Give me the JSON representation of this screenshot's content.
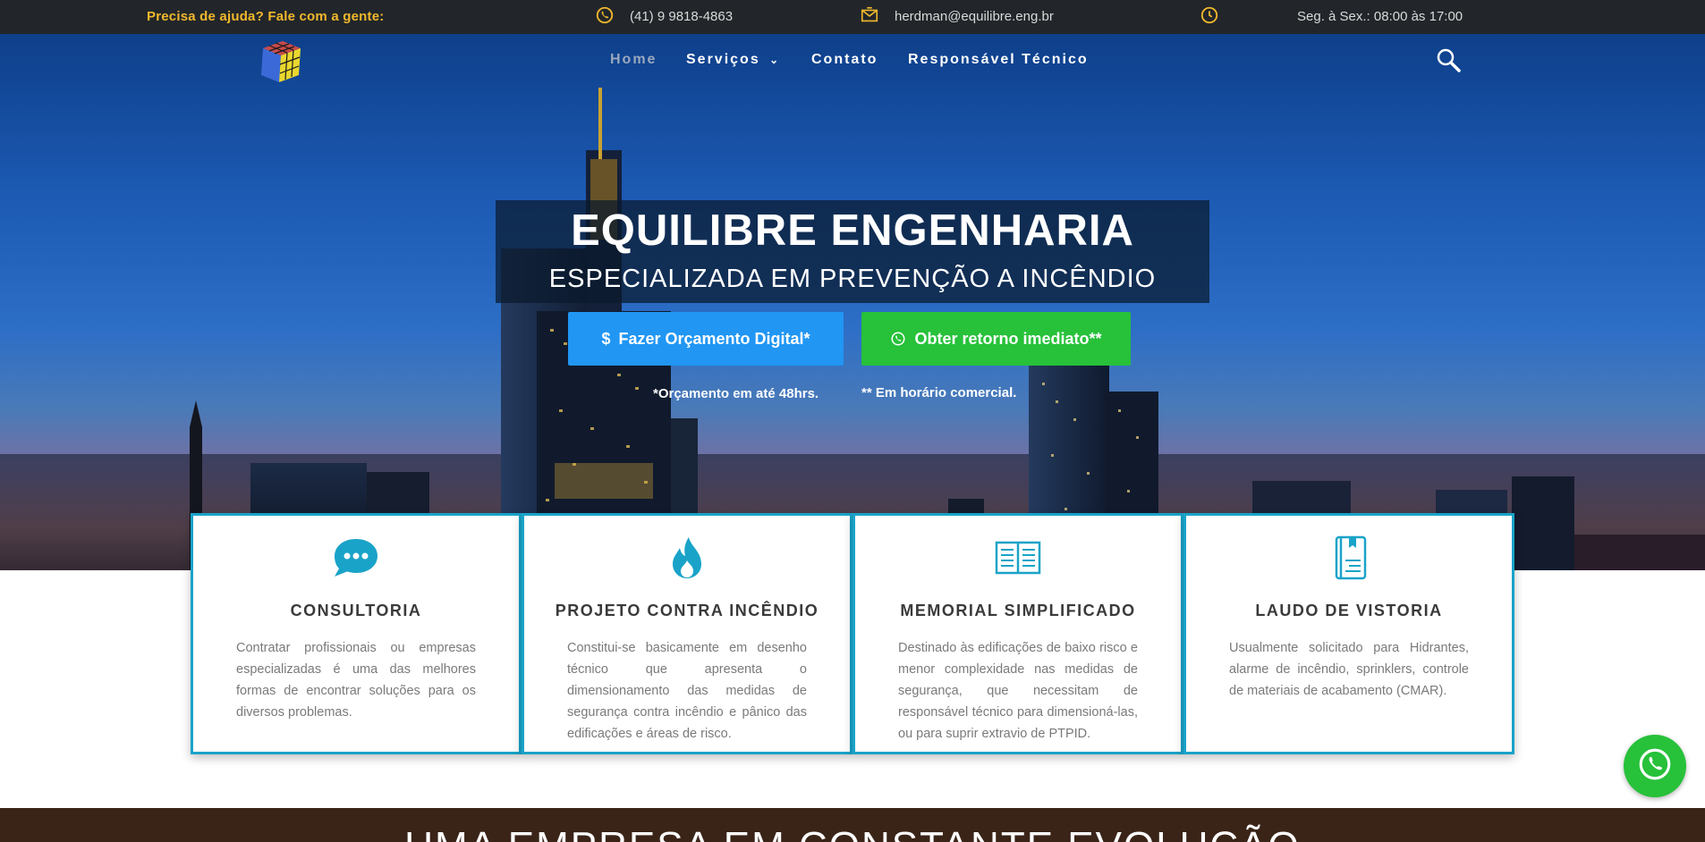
{
  "topbar": {
    "help": "Precisa de ajuda? Fale com a gente:",
    "phone": "(41) 9 9818-4863",
    "email": "herdman@equilibre.eng.br",
    "hours": "Seg. à Sex.: 08:00 às 17:00"
  },
  "nav": {
    "home": "Home",
    "services": "Serviços",
    "contact": "Contato",
    "technical": "Responsável Técnico"
  },
  "hero": {
    "title": "EQUILIBRE ENGENHARIA",
    "subtitle": "ESPECIALIZADA EM PREVENÇÃO A INCÊNDIO",
    "btn_quote": "Fazer Orçamento Digital*",
    "btn_callback": "Obter retorno imediato**",
    "note_quote": "*Orçamento em até 48hrs.",
    "note_callback": "** Em horário comercial."
  },
  "services": [
    {
      "title": "CONSULTORIA",
      "text": "Contratar profissionais ou empresas especializadas é uma das melhores formas de encontrar soluções para os diversos problemas.",
      "icon": "chat-bubble-icon"
    },
    {
      "title": "PROJETO CONTRA INCÊNDIO",
      "text": "Constitui-se basicamente em desenho técnico que apresenta o dimensionamento das medidas de segurança contra incêndio e pânico das edificações e áreas de risco.",
      "icon": "flame-icon"
    },
    {
      "title": "MEMORIAL SIMPLIFICADO",
      "text": "Destinado às edificações de baixo risco e menor complexidade nas medidas de segurança, que necessitam de responsável técnico para dimensioná-las, ou para suprir extravio de PTPID.",
      "icon": "open-book-icon"
    },
    {
      "title": "LAUDO DE VISTORIA",
      "text": "Usualmente solicitado para Hidrantes, alarme de incêndio, sprinklers, controle de materiais de acabamento (CMAR).",
      "icon": "document-book-icon"
    }
  ],
  "bottom": {
    "heading": "UMA EMPRESA EM CONSTANTE EVOLUÇÃO"
  },
  "colors": {
    "accent_yellow": "#f1b82d",
    "card_border": "#1aa3c8",
    "btn_blue": "#2196f3",
    "btn_green": "#27c13a",
    "topbar_bg": "#22262a"
  }
}
